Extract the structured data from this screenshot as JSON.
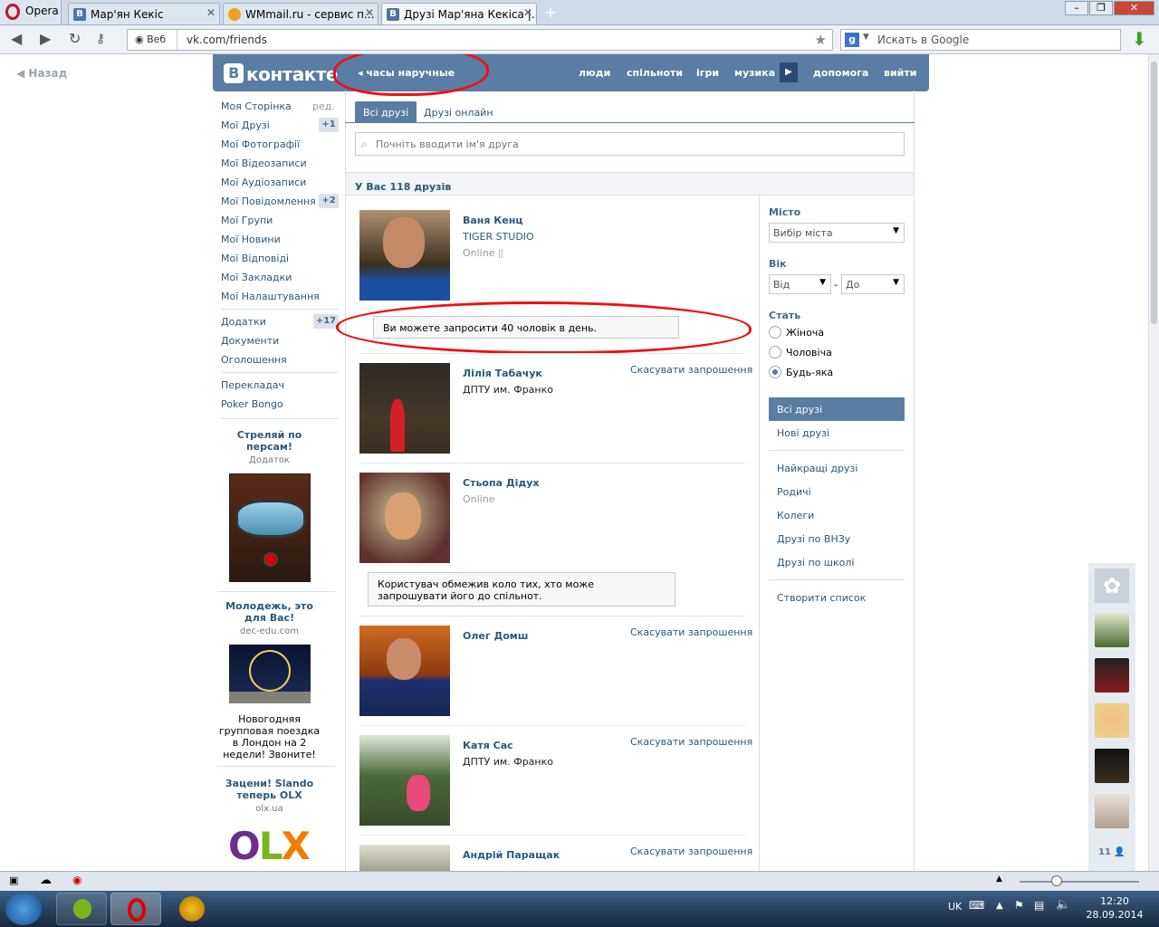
{
  "browser": {
    "app_name": "Opera",
    "tabs": [
      {
        "label": "Мар'ян Кекіс"
      },
      {
        "label": "WMmail.ru - сервис п..."
      },
      {
        "label": "Друзі Мар'яна Кекіса |..."
      }
    ],
    "web_label": "Веб",
    "url": "vk.com/friends",
    "search_placeholder": "Искать в Google"
  },
  "page": {
    "back_label": "Назад",
    "logo": "контакте",
    "logo_letter": "В",
    "ad_text": "часы наручные",
    "nav": [
      "люди",
      "спільноти",
      "ігри",
      "музика",
      "допомога",
      "вийти"
    ]
  },
  "left_menu": {
    "items": [
      {
        "label": "Моя Сторінка",
        "extra": "ред."
      },
      {
        "label": "Мої Друзі",
        "count": "+1"
      },
      {
        "label": "Мої Фотографії"
      },
      {
        "label": "Мої Відеозаписи"
      },
      {
        "label": "Мої Аудіозаписи"
      },
      {
        "label": "Мої Повідомлення",
        "count": "+2"
      },
      {
        "label": "Мої Групи"
      },
      {
        "label": "Мої Новини"
      },
      {
        "label": "Мої Відповіді"
      },
      {
        "label": "Мої Закладки"
      },
      {
        "label": "Мої Налаштування"
      }
    ],
    "apps": [
      {
        "label": "Додатки",
        "count": "+17"
      },
      {
        "label": "Документи"
      },
      {
        "label": "Оголошення"
      }
    ],
    "extra": [
      {
        "label": "Перекладач"
      },
      {
        "label": "Poker Bongo"
      }
    ]
  },
  "ads": [
    {
      "title": "Стреляй по персам!",
      "sub": "Додаток"
    },
    {
      "title": "Молодежь, это для Вас!",
      "sub": "dec-edu.com",
      "text": "Новогодняя групповая поездка в Лондон на 2 недели! Звоните!"
    },
    {
      "title": "Зацени! Slando теперь OLX",
      "sub": "olx.ua",
      "logo": "OLX"
    }
  ],
  "friends_page": {
    "tabs": [
      "Всі друзі",
      "Друзі онлайн"
    ],
    "search_placeholder": "Почніть вводити ім'я друга",
    "count_text": "У Вас 118 друзів",
    "friends": [
      {
        "name": "Ваня Кенц",
        "sub": "TIGER STUDIO",
        "status": "Online"
      },
      {
        "name": "Лілія Табачук",
        "sub": "ДПТУ им. Франко",
        "action": "Скасувати запрошення"
      },
      {
        "name": "Стьопа Дідух",
        "status": "Online"
      },
      {
        "name": "Олег Домш",
        "action": "Скасувати запрошення"
      },
      {
        "name": "Катя Сас",
        "sub": "ДПТУ им. Франко",
        "action": "Скасувати запрошення"
      },
      {
        "name": "Андрій Паращак",
        "action": "Скасувати запрошення"
      }
    ],
    "notice_invite": "Ви можете запросити 40 чоловік в день.",
    "notice_limit": "Користувач обмежив коло тих, хто може запрошувати його до спільнот."
  },
  "filters": {
    "city_label": "Місто",
    "city_value": "Вибір міста",
    "age_label": "Вік",
    "age_from": "Від",
    "age_dash": "-",
    "age_to": "До",
    "sex_label": "Стать",
    "sex_options": [
      "Жіноча",
      "Чоловіча",
      "Будь-яка"
    ],
    "sex_selected": "Будь-яка",
    "lists_active": "Всі друзі",
    "lists": [
      "Нові друзі",
      "Найкращі друзі",
      "Родичі",
      "Колеги",
      "Друзі по ВНЗу",
      "Друзі по школі"
    ],
    "create_list": "Створити список"
  },
  "side_strip": {
    "count": "11"
  },
  "taskbar": {
    "lang": "UK",
    "time": "12:20",
    "date": "28.09.2014"
  },
  "colors": {
    "vk_blue": "#597da3",
    "link": "#2b587a",
    "annotation_red": "#e11111"
  }
}
